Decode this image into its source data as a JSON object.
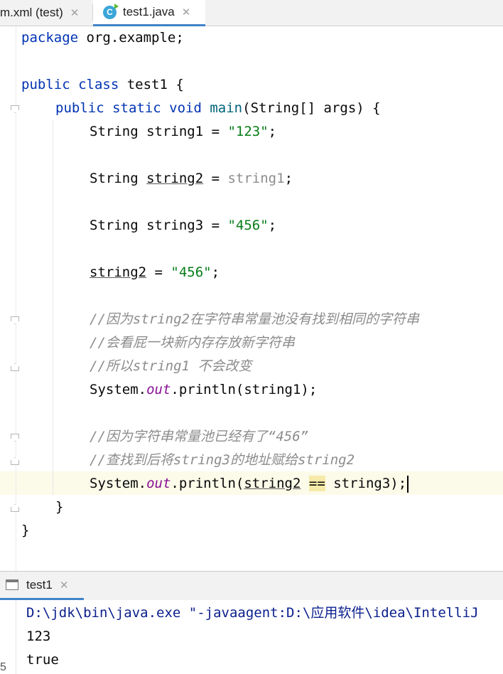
{
  "tabs": {
    "pom_label": "m.xml (test)",
    "java_label": "test1.java",
    "close_glyph": "✕",
    "java_icon_letter": "C"
  },
  "code": {
    "l1_kw": "package",
    "l1_rest": " org.example;",
    "l3_kw": "public class",
    "l3_rest": " test1 {",
    "l4_kw": "public static void",
    "l4_fn": "main",
    "l4_rest": "(String[] args) {",
    "l5_pre": "String string1 = ",
    "l5_str": "\"123\"",
    "l5_end": ";",
    "l7_pre": "String ",
    "l7_var": "string2",
    "l7_mid": " = ",
    "l7_gray": "string1",
    "l7_end": ";",
    "l9_pre": "String string3 = ",
    "l9_str": "\"456\"",
    "l9_end": ";",
    "l11_var": "string2",
    "l11_mid": " = ",
    "l11_str": "\"456\"",
    "l11_end": ";",
    "c1": "//因为string2在字符串常量池没有找到相同的字符串",
    "c2": "//会看屁一块新内存存放新字符串",
    "c3": "//所以string1 不会改变",
    "l16_pre": "System.",
    "l16_field": "out",
    "l16_rest": ".println(string1);",
    "c4": "//因为字符串常量池已经有了“456”",
    "c5": "//查找到后将string3的地址赋给string2",
    "l20_pre": "System.",
    "l20_field": "out",
    "l20_mid": ".println(",
    "l20_var": "string2",
    "l20_sp": " ",
    "l20_eq": "==",
    "l20_rest": " string3);",
    "close_method": "}",
    "close_class": "}"
  },
  "run": {
    "tab_label": "test1",
    "close_glyph": "✕",
    "output": [
      "D:\\jdk\\bin\\java.exe \"-javaagent:D:\\应用软件\\idea\\IntelliJ",
      "123",
      "true"
    ],
    "side_marker": "5"
  }
}
